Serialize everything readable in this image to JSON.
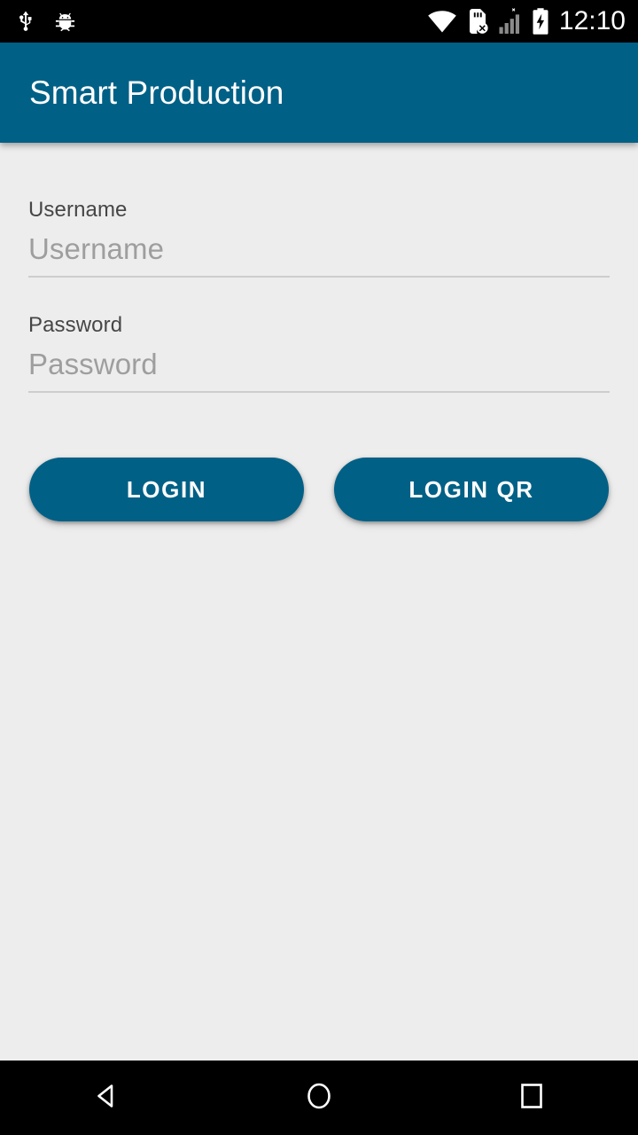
{
  "status_bar": {
    "left_icons": [
      {
        "name": "usb-debug-icon",
        "label": "USB"
      },
      {
        "name": "android-bug-icon",
        "label": "Debug"
      }
    ],
    "right_icons": [
      {
        "name": "wifi-icon",
        "label": "Wi-Fi"
      },
      {
        "name": "no-sim-card-icon",
        "label": "No SIM card"
      },
      {
        "name": "no-signal-icon",
        "label": "No service"
      },
      {
        "name": "battery-charging-icon",
        "label": "Charging"
      }
    ],
    "clock": "12:10",
    "background": "#000000",
    "foreground": "#ffffff"
  },
  "app_bar": {
    "title": "Smart Production",
    "background": "#016086",
    "text_color": "#ffffff"
  },
  "form": {
    "fields": [
      {
        "key": "username",
        "label": "Username",
        "placeholder": "Username",
        "value": "",
        "type": "text"
      },
      {
        "key": "password",
        "label": "Password",
        "placeholder": "Password",
        "value": "",
        "type": "password"
      }
    ]
  },
  "actions": {
    "login_label": "LOGIN",
    "login_qr_label": "LOGIN QR",
    "button_color": "#016086",
    "button_text_color": "#ffffff"
  },
  "nav_bar": {
    "back": "back-icon",
    "home": "home-icon",
    "recents": "recents-icon",
    "background": "#000000"
  },
  "theme": {
    "body_background": "#ededed",
    "label_color": "#464646",
    "placeholder_color": "#9e9e9e",
    "underline_color": "#cdcdcd",
    "accent": "#016086"
  }
}
